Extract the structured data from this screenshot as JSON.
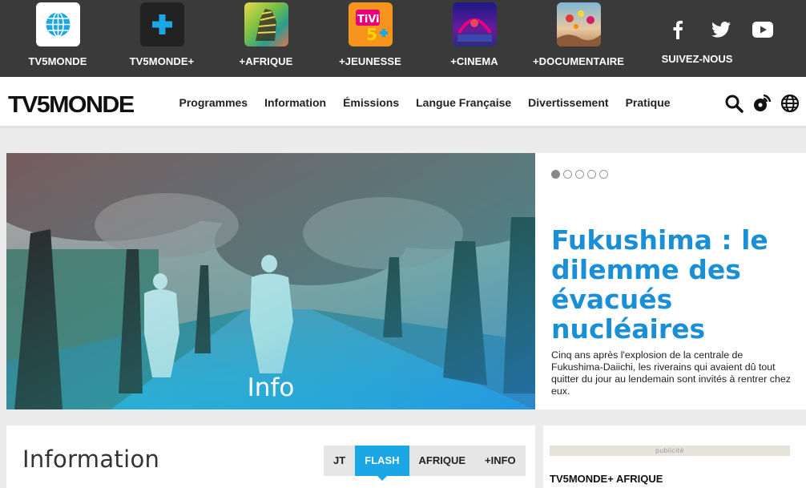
{
  "channels": [
    {
      "label": "TV5MONDE",
      "icon": "globe-icon"
    },
    {
      "label": "TV5MONDE+",
      "icon": "plus-icon"
    },
    {
      "label": "+AFRIQUE",
      "icon": "zebra-icon"
    },
    {
      "label": "+JEUNESSE",
      "icon": "tivi5-icon"
    },
    {
      "label": "+CINEMA",
      "icon": "cinema-icon"
    },
    {
      "label": "+DOCUMENTAIRE",
      "icon": "balloons-icon"
    }
  ],
  "social": {
    "label": "SUIVEZ-NOUS",
    "icons": [
      "facebook-icon",
      "twitter-icon",
      "youtube-icon"
    ]
  },
  "brand": "TV5MONDE",
  "nav": [
    "Programmes",
    "Information",
    "Émissions",
    "Langue Française",
    "Divertissement",
    "Pratique"
  ],
  "hero": {
    "label": "Info",
    "title": "Fukushima : le dilemme des évacués nucléaires",
    "description": "Cinq ans après l'explosion de la centrale de Fukushima-Daiichi, les riverains qui avaient dû tout quitter du jour au lendemain sont invités à rentrer chez eux.",
    "slides": 5,
    "active_slide": 1
  },
  "info_section": {
    "title": "Information",
    "tabs": [
      "JT",
      "FLASH",
      "AFRIQUE",
      "+INFO"
    ],
    "active_tab": "FLASH"
  },
  "sidebar": {
    "ad_label": "publicité",
    "title": "TV5MONDE+ AFRIQUE"
  },
  "colors": {
    "accent": "#1ba6e6",
    "topbar": "#3a3a3a",
    "title_blue": "#1a8fd6"
  }
}
